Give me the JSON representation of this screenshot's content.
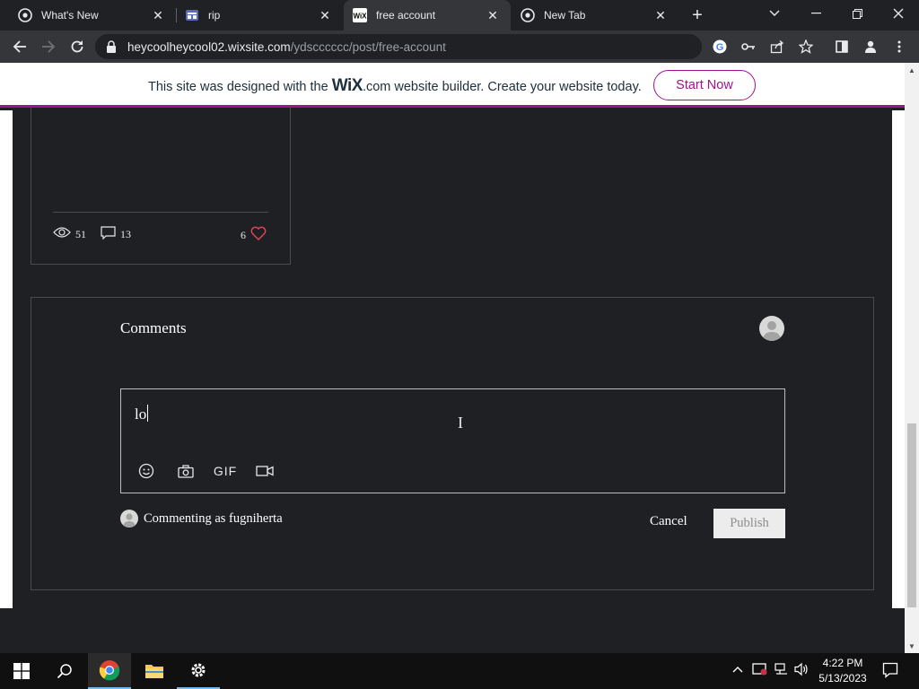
{
  "browser": {
    "tabs": [
      {
        "title": "What's New",
        "active": false
      },
      {
        "title": "rip",
        "active": false
      },
      {
        "title": "free account",
        "active": true
      },
      {
        "title": "New Tab",
        "active": false
      }
    ],
    "url_host": "heycoolheycool02.wixsite.com",
    "url_path": "/ydscccccc/post/free-account"
  },
  "wix_banner": {
    "text_before": "This site was designed with the",
    "logo": "WiX",
    "text_after": ".com website builder. Create your website today.",
    "cta": "Start Now"
  },
  "post_card": {
    "views": "51",
    "comments": "13",
    "likes": "6"
  },
  "comments": {
    "title": "Comments",
    "draft_text": "lo",
    "tools": {
      "gif_label": "GIF"
    },
    "commenting_as": "Commenting as fugniherta",
    "cancel_label": "Cancel",
    "publish_label": "Publish"
  },
  "taskbar": {
    "time": "4:22 PM",
    "date": "5/13/2023"
  },
  "colors": {
    "wix_accent": "#a0138e",
    "heart": "#e8475f",
    "page_dark": "#1f2024"
  }
}
